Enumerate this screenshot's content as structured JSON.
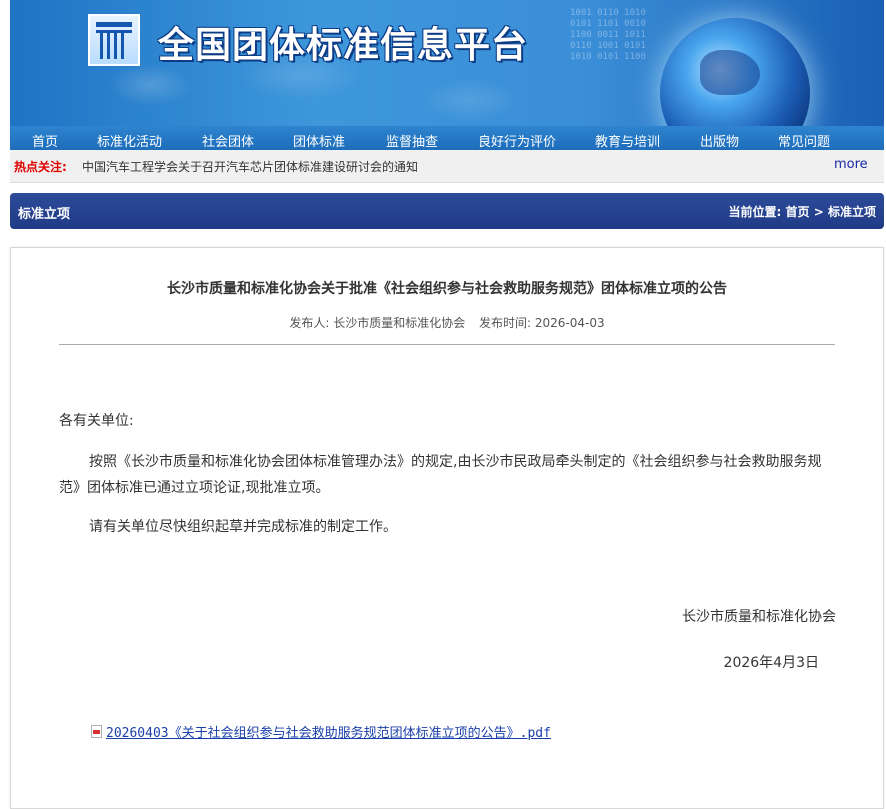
{
  "site": {
    "title": "全国团体标准信息平台",
    "banner_digits": "1001 0110 1010\n0101 1101 0010\n1100 0011 1011\n0110 1001 0101\n1010 0101 1100"
  },
  "nav": {
    "items": [
      "首页",
      "标准化活动",
      "社会团体",
      "团体标准",
      "监督抽查",
      "良好行为评价",
      "教育与培训",
      "出版物",
      "常见问题"
    ]
  },
  "hot": {
    "label": "热点关注:",
    "news": "中国汽车工程学会关于召开汽车芯片团体标准建设研讨会的通知",
    "more": "more"
  },
  "section": {
    "title": "标准立项",
    "crumb_prefix": "当前位置:",
    "crumb_home": "首页",
    "crumb_sep": ">",
    "crumb_current": "标准立项"
  },
  "article": {
    "title": "长沙市质量和标准化协会关于批准《社会组织参与社会救助服务规范》团体标准立项的公告",
    "publisher": "发布人: 长沙市质量和标准化协会",
    "publish_time": "发布时间: 2026-04-03",
    "salutation": "各有关单位:",
    "paragraph1": "按照《长沙市质量和标准化协会团体标准管理办法》的规定,由长沙市民政局牵头制定的《社会组织参与社会救助服务规范》团体标准已通过立项论证,现批准立项。",
    "paragraph2": "请有关单位尽快组织起草并完成标准的制定工作。",
    "signature": "长沙市质量和标准化协会",
    "date": "2026年4月3日",
    "attachment": "20260403《关于社会组织参与社会救助服务规范团体标准立项的公告》.pdf"
  },
  "colors": {
    "nav_bg": "#1d6dba",
    "section_bg": "#203b86",
    "hot_label": "#e00000",
    "more_link": "#1a28a8",
    "attachment_link": "#1a3fa8"
  }
}
